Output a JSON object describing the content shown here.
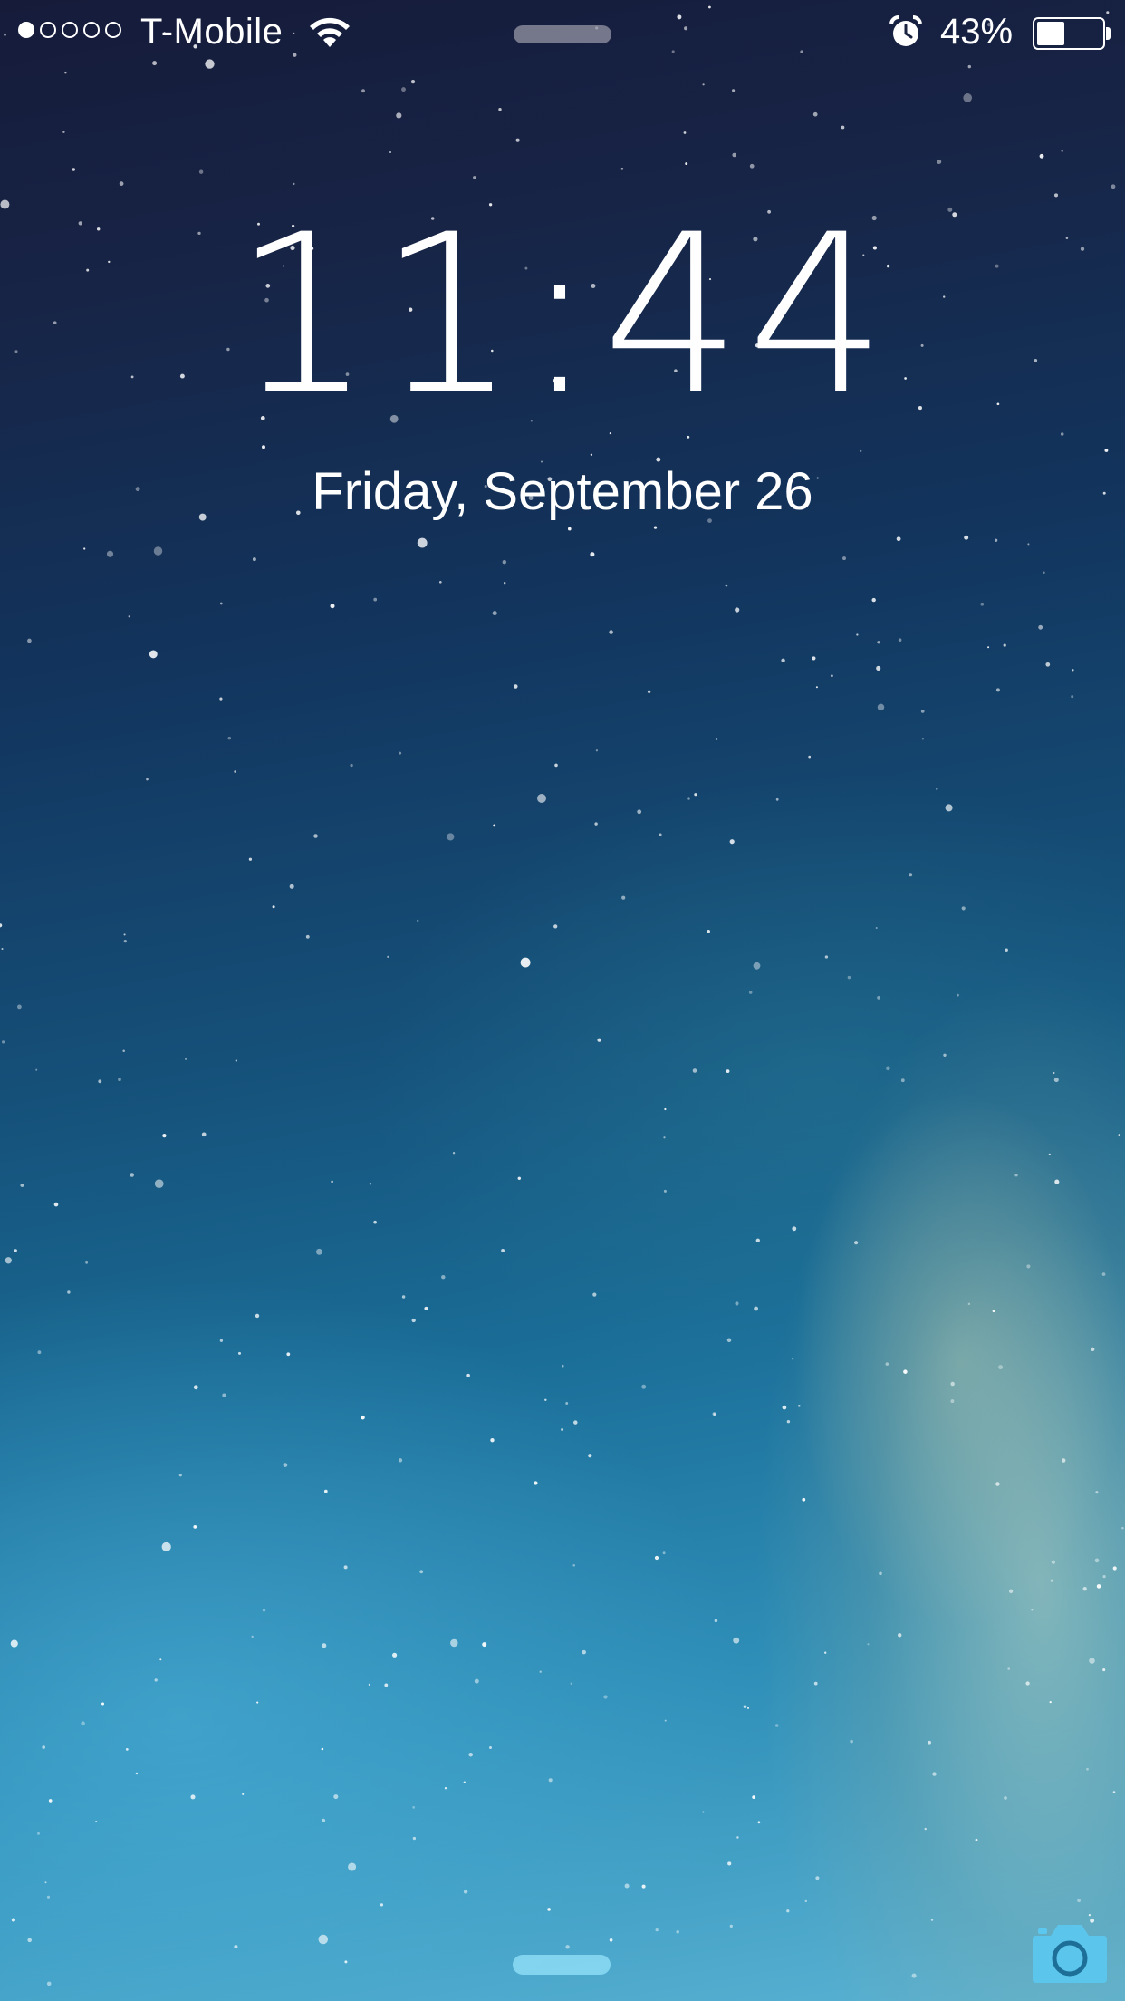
{
  "status_bar": {
    "signal_strength": 1,
    "signal_max": 5,
    "carrier": "T-Mobile",
    "wifi_icon": "wifi-icon",
    "alarm_icon": "alarm-clock-icon",
    "battery_percent_label": "43%",
    "battery_level": 0.43
  },
  "lock_screen": {
    "time": "11:44",
    "date": "Friday, September 26"
  },
  "controls": {
    "notification_grabber": "top-grabber",
    "control_center_grabber": "bottom-grabber",
    "camera_icon": "camera-icon"
  },
  "colors": {
    "text": "#ffffff",
    "bottom_grabber": "#8cdcf5",
    "camera": "#5cc8f0"
  }
}
